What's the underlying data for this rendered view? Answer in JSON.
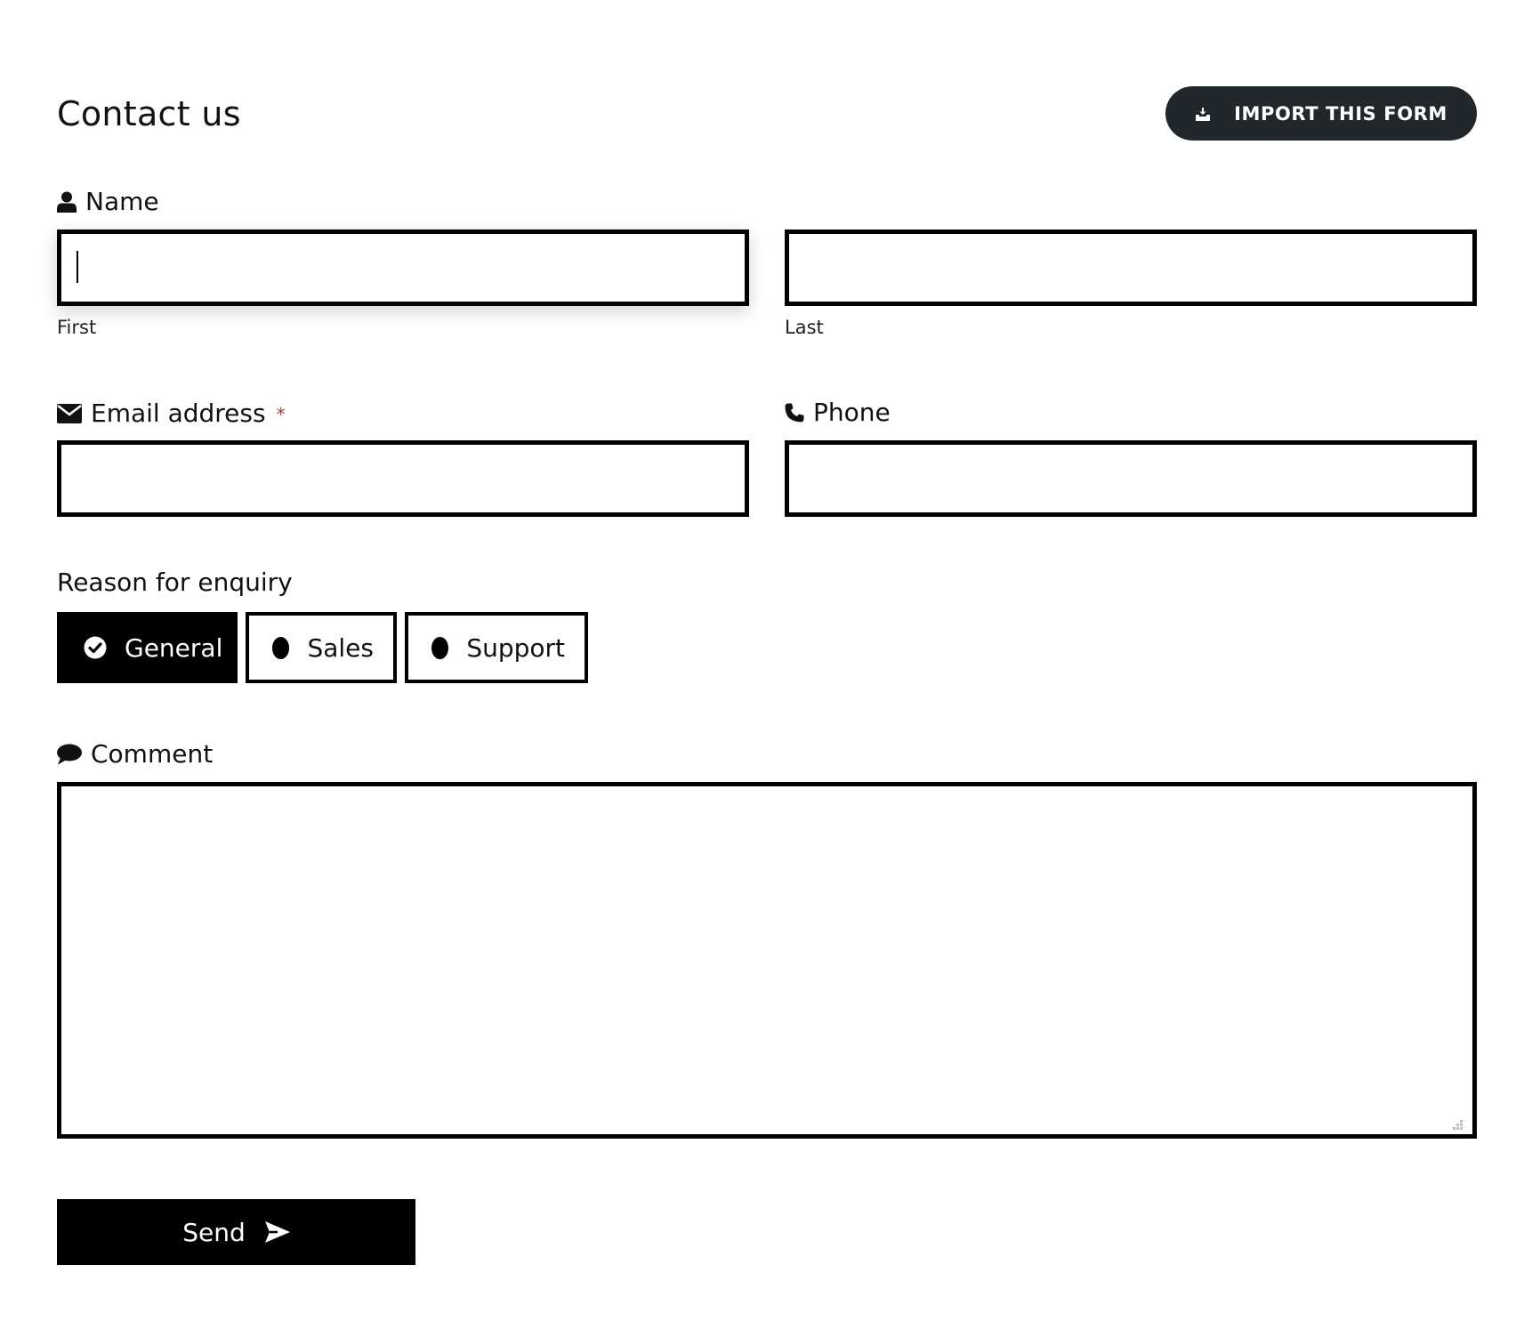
{
  "header": {
    "title": "Contact us",
    "import_button_label": "IMPORT THIS FORM",
    "import_icon": "inbox-download-icon"
  },
  "name_field": {
    "label": "Name",
    "icon": "user-icon",
    "first": {
      "value": "",
      "sub_label": "First"
    },
    "last": {
      "value": "",
      "sub_label": "Last"
    }
  },
  "email_field": {
    "label": "Email address",
    "required_marker": "*",
    "icon": "envelope-icon",
    "value": ""
  },
  "phone_field": {
    "label": "Phone",
    "icon": "phone-icon",
    "value": ""
  },
  "reason": {
    "label": "Reason for enquiry",
    "selected": "General",
    "options": [
      {
        "label": "General",
        "selected": true
      },
      {
        "label": "Sales",
        "selected": false
      },
      {
        "label": "Support",
        "selected": false
      }
    ]
  },
  "comment_field": {
    "label": "Comment",
    "icon": "speech-bubble-icon",
    "value": ""
  },
  "send_button": {
    "label": "Send",
    "icon": "paper-plane-icon"
  },
  "colors": {
    "import_button_bg": "#22272b",
    "border": "#000000",
    "required": "#c0392b"
  }
}
